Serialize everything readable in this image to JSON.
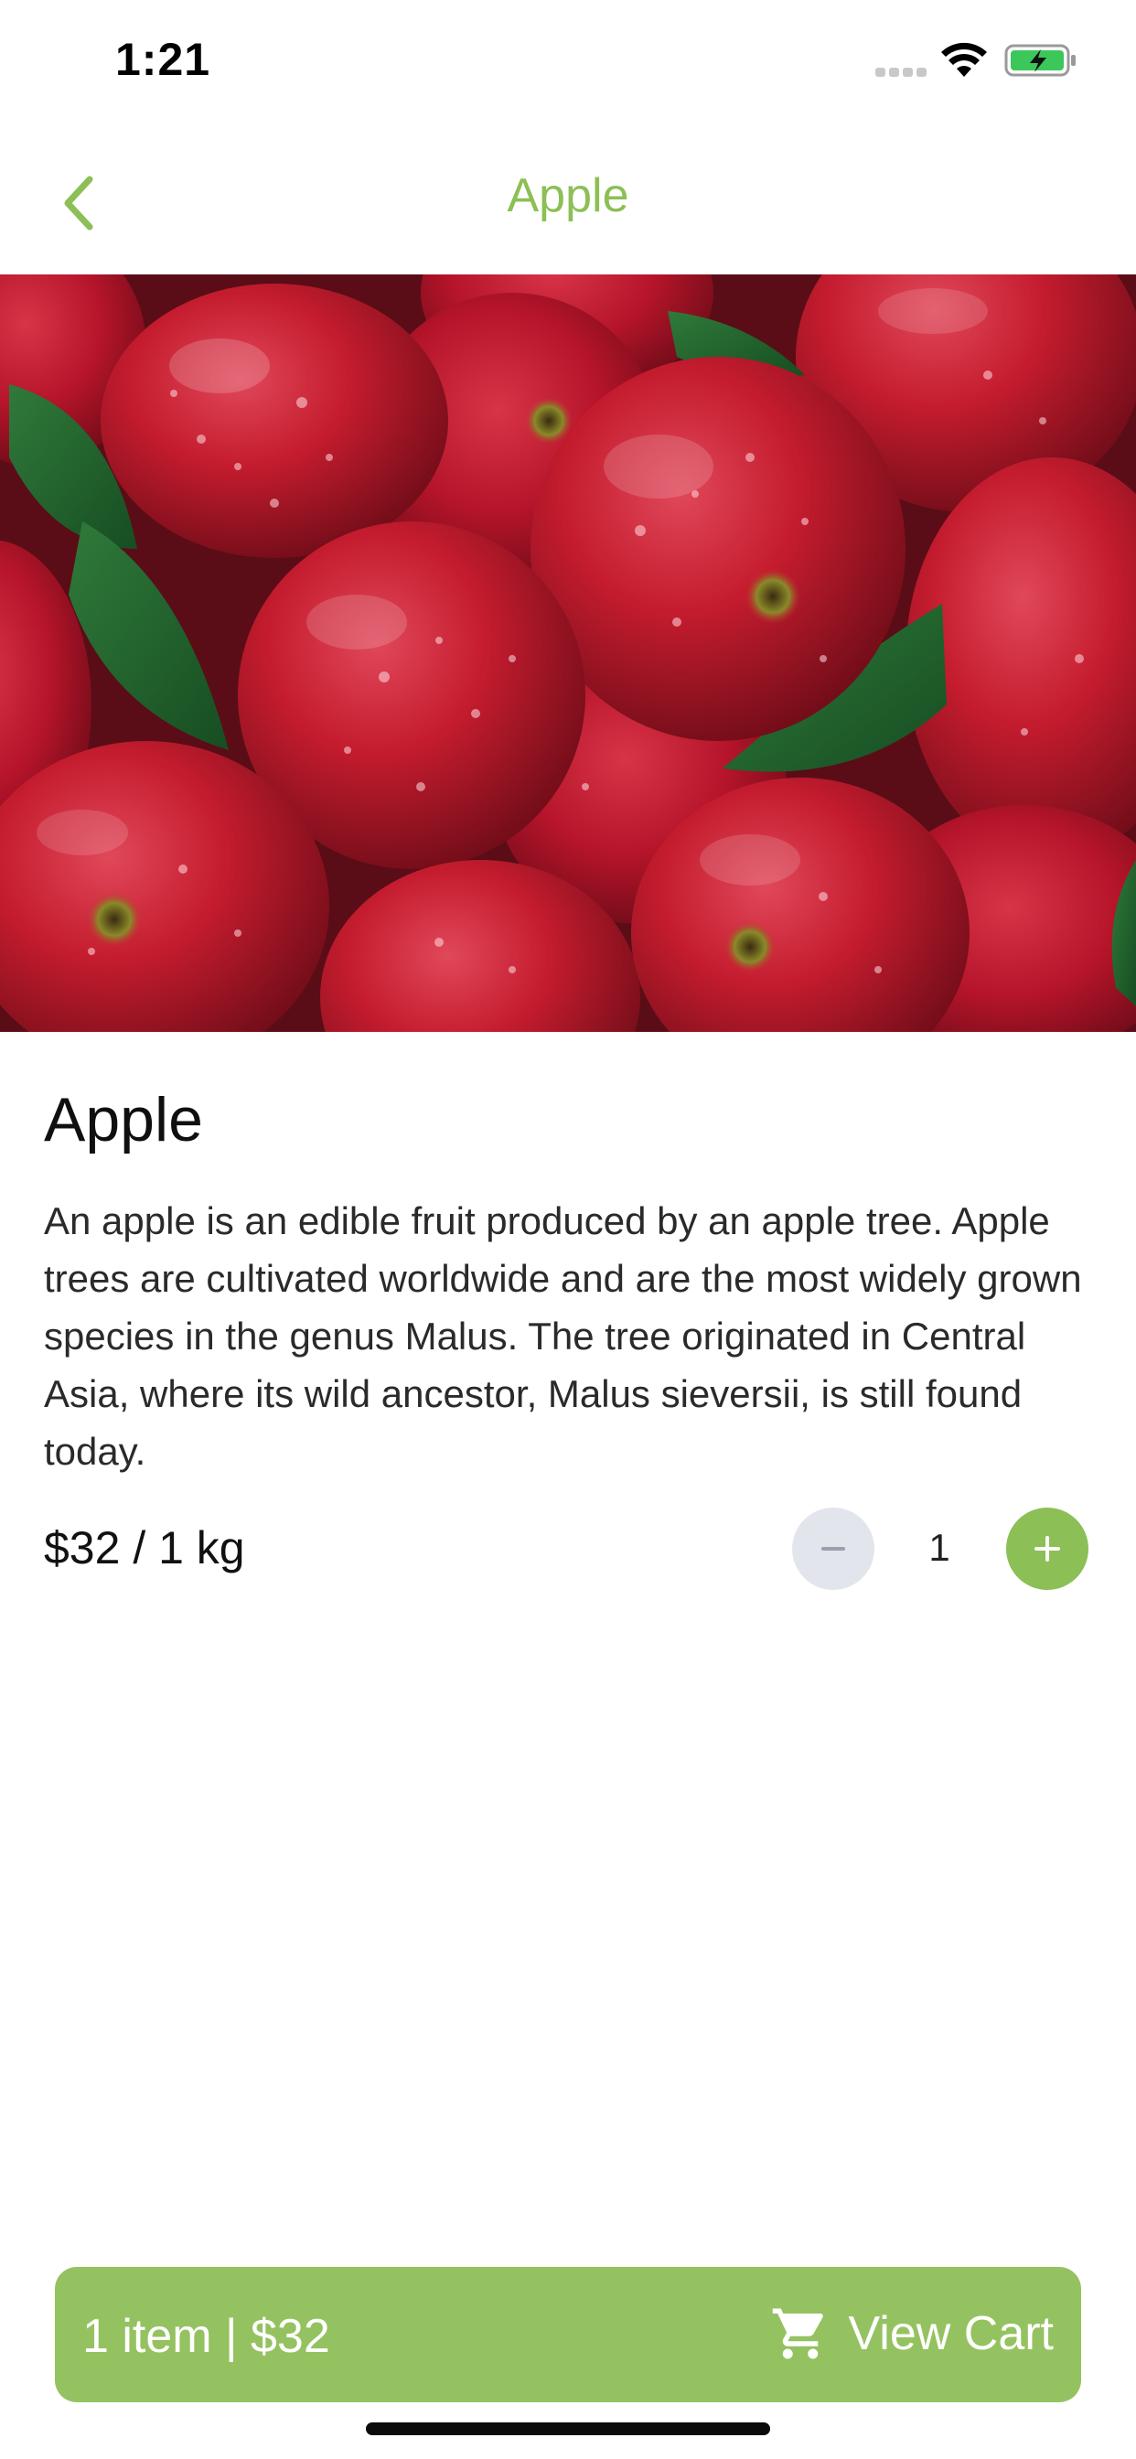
{
  "status_bar": {
    "time": "1:21",
    "icons": [
      "cellular-signal-icon",
      "wifi-icon",
      "battery-charging-icon"
    ]
  },
  "nav": {
    "back_icon": "chevron-left-icon",
    "title": "Apple"
  },
  "hero": {
    "image": "red apples with water droplets and green leaves"
  },
  "product": {
    "name": "Apple",
    "description": "An apple is an edible fruit produced by an apple tree. Apple trees are cultivated worldwide and are the most widely grown species in the genus Malus. The tree originated in Central Asia, where its wild ancestor, Malus sieversii, is still found today.",
    "price": "$32 / 1 kg",
    "quantity": "1"
  },
  "cart": {
    "summary": "1 item | $32",
    "action_label": "View Cart",
    "icon": "shopping-cart-icon"
  },
  "colors": {
    "accent": "#8cbf55",
    "cart_bar": "#95c260",
    "minus_button": "#e3e5ec"
  }
}
